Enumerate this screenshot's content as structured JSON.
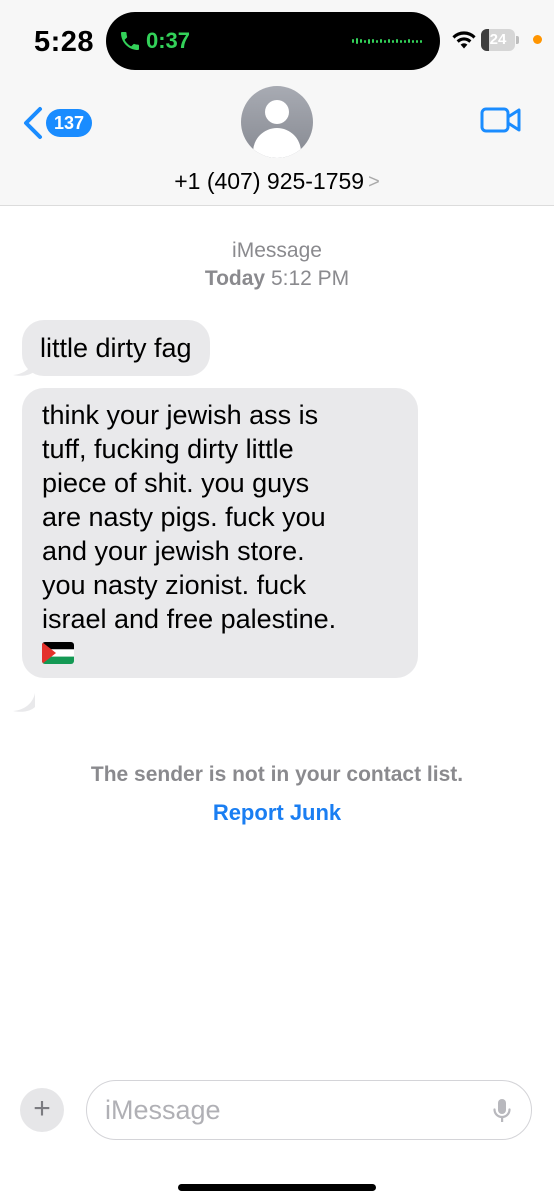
{
  "status_bar": {
    "time": "5:28",
    "call_timer": "0:37",
    "battery_level": "24",
    "accent_green": "#33d159",
    "icons": [
      "phone-icon",
      "waveform-icon",
      "wifi-icon",
      "battery-icon",
      "mic-indicator-dot"
    ]
  },
  "nav": {
    "back_badge": "137",
    "contact_name": "+1 (407) 925-1759",
    "contact_chevron": ">",
    "icons": [
      "chevron-left-icon",
      "avatar-icon",
      "facetime-video-icon"
    ],
    "accent_blue": "#1a8cff"
  },
  "conversation": {
    "service": "iMessage",
    "date_day": "Today",
    "date_time": "5:12 PM",
    "messages": [
      {
        "text": "little dirty fag"
      },
      {
        "lines": [
          "think your jewish ass is",
          "tuff, fucking dirty little",
          "piece of shit. you guys",
          "are nasty pigs. fuck you",
          "and your jewish store.",
          "you nasty zionist. fuck",
          "israel and free palestine."
        ],
        "emoji": "palestine-flag-emoji"
      }
    ],
    "bubble_color": "#e9e9eb"
  },
  "junk": {
    "notice": "The sender is not in your contact list.",
    "report_label": "Report Junk"
  },
  "compose": {
    "plus_label": "+",
    "placeholder": "iMessage",
    "value": "",
    "icons": [
      "plus-icon",
      "microphone-icon"
    ]
  }
}
